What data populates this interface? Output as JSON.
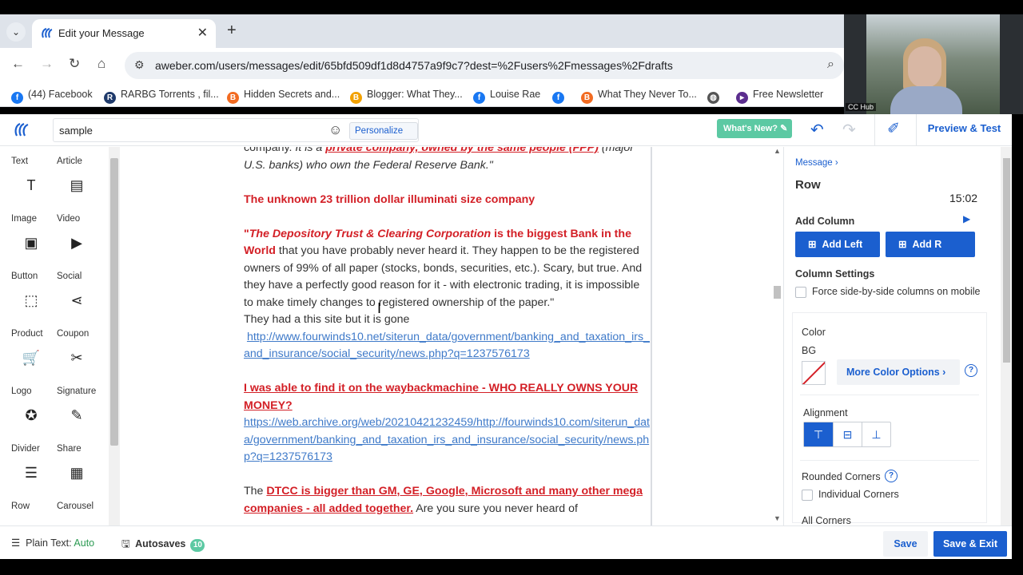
{
  "browser": {
    "tab_title": "Edit your Message",
    "url": "aweber.com/users/messages/edit/65bfd509df1d8d4757a9f9c7?dest=%2Fusers%2Fmessages%2Fdrafts",
    "bookmarks": [
      {
        "label": "(44) Facebook",
        "icon": "facebook-icon",
        "color": "#1877f2"
      },
      {
        "label": "RARBG Torrents , fil...",
        "icon": "rarbg-icon",
        "color": "#1f3a6b"
      },
      {
        "label": "Hidden Secrets and...",
        "icon": "blogger-icon",
        "color": "#f26b21"
      },
      {
        "label": "Blogger: What They...",
        "icon": "blogger-icon",
        "color": "#f2a100"
      },
      {
        "label": "Louise Rae",
        "icon": "facebook-icon",
        "color": "#1877f2"
      },
      {
        "label": "",
        "icon": "facebook-icon",
        "color": "#1877f2"
      },
      {
        "label": "What They Never To...",
        "icon": "blogger-icon",
        "color": "#f26b21"
      },
      {
        "label": "",
        "icon": "globe-icon",
        "color": "#555555"
      },
      {
        "label": "Free Newsletter",
        "icon": "newsletter-icon",
        "color": "#5b2d8e"
      }
    ]
  },
  "webcam": {
    "caption": "CC Hub"
  },
  "header": {
    "subject_value": "sample",
    "personalize_label": "Personalize",
    "whats_new_label": "What's New?",
    "preview_label": "Preview & Test"
  },
  "palette": [
    {
      "label": "Text",
      "icon": "text-icon",
      "glyph": "T"
    },
    {
      "label": "Article",
      "icon": "article-icon",
      "glyph": "▤"
    },
    {
      "label": "Image",
      "icon": "image-icon",
      "glyph": "▣"
    },
    {
      "label": "Video",
      "icon": "video-icon",
      "glyph": "▶"
    },
    {
      "label": "Button",
      "icon": "button-icon",
      "glyph": "⬚"
    },
    {
      "label": "Social",
      "icon": "social-icon",
      "glyph": "⋖"
    },
    {
      "label": "Product",
      "icon": "cart-icon",
      "glyph": "🛒"
    },
    {
      "label": "Coupon",
      "icon": "scissors-icon",
      "glyph": "✂"
    },
    {
      "label": "Logo",
      "icon": "logo-icon",
      "glyph": "✪"
    },
    {
      "label": "Signature",
      "icon": "pen-icon",
      "glyph": "✎"
    },
    {
      "label": "Divider",
      "icon": "divider-icon",
      "glyph": "☰"
    },
    {
      "label": "Share",
      "icon": "share-icon",
      "glyph": "▦"
    },
    {
      "label": "Row",
      "icon": "row-icon",
      "glyph": ""
    },
    {
      "label": "Carousel",
      "icon": "carousel-icon",
      "glyph": ""
    }
  ],
  "content": {
    "p1_a": "company. ",
    "p1_b": "It is a ",
    "p1_c": "private company, owned by the same people (FPP)",
    "p1_d": " (major U.S. banks) who own the Federal Reserve Bank.\"",
    "p2": "The unknown 23 trillion dollar illuminati size company",
    "p3_q": "\"",
    "p3_dtcc": "The Depository Trust & Clearing Corporation",
    "p3_bold": " is the biggest Bank in the World",
    "p3_rest": " that you have probably never heard it. They happen to be the registered owners of 99% of all paper (stocks, bonds, securities, etc.). Scary, but true. And they have a perfectly good reason for it - with electronic trading, it is impossible to make timely changes to registered ownership of the paper.\"",
    "p4": "They had a this site but it is gone",
    "link1": "http://www.fourwinds10.net/siterun_data/government/banking_and_taxation_irs_and_insurance/social_security/news.php?q=1237576173",
    "p5": "I was able to find it on the waybackmachine - WHO REALLY OWNS YOUR MONEY?",
    "link2": "https://web.archive.org/web/20210421232459/http://fourwinds10.com/siterun_data/government/banking_and_taxation_irs_and_insurance/social_security/news.php?q=1237576173",
    "p6_a": "The ",
    "p6_b": "DTCC",
    "p6_c": " is bigger than GM, GE, Google, Microsoft and many other mega companies - all added together.",
    "p6_d": " Are you sure you never heard of"
  },
  "panel": {
    "breadcrumb": "Message ›",
    "title": "Row",
    "timer": "15:02",
    "add_column": "Add Column",
    "add_left": "Add Left",
    "add_right": "Add R",
    "column_settings": "Column Settings",
    "force_side": "Force side-by-side columns on mobile",
    "color": "Color",
    "bg": "BG",
    "more_color": "More Color Options  ›",
    "alignment": "Alignment",
    "rounded": "Rounded Corners",
    "individual": "Individual Corners",
    "all_corners": "All Corners"
  },
  "footer": {
    "plain_text": "Plain Text: ",
    "plain_text_value": "Auto",
    "autosaves": "Autosaves",
    "autosaves_count": "10",
    "save": "Save",
    "save_exit": "Save & Exit"
  },
  "colors": {
    "accent": "#1b5fcf",
    "red_text": "#d31f26",
    "link": "#3f7ac9",
    "green": "#5cc9a3"
  }
}
